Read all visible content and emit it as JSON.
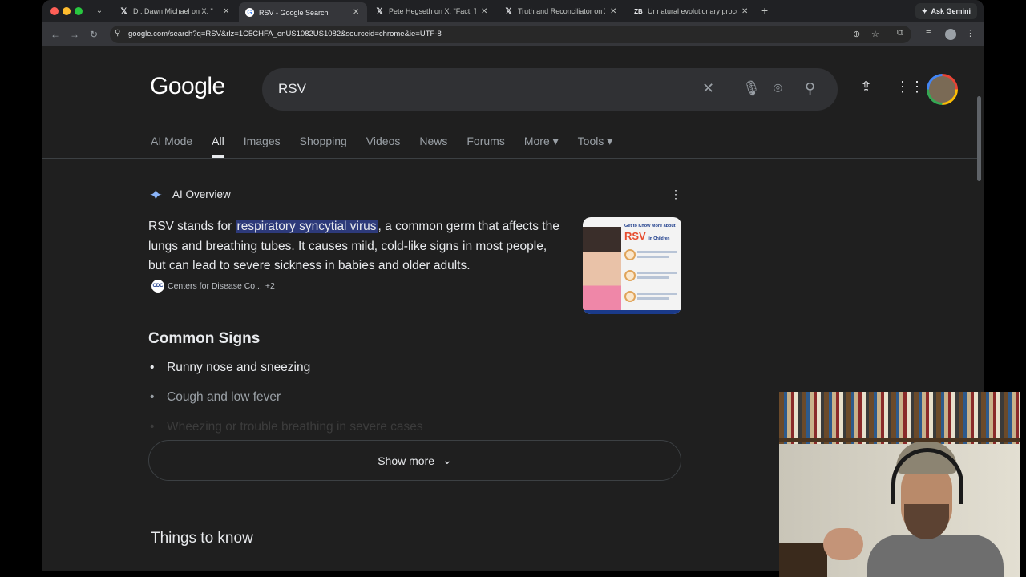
{
  "browser": {
    "tabs": [
      {
        "title": "Dr. Dawn Michael on X: \"",
        "favicon": "x-logo-icon",
        "active": false
      },
      {
        "title": "RSV - Google Search",
        "favicon": "google-g-icon",
        "active": true
      },
      {
        "title": "Pete Hegseth on X: \"Fact. Th",
        "favicon": "x-logo-icon",
        "active": false
      },
      {
        "title": "Truth and Reconciliator on X:",
        "favicon": "x-logo-icon",
        "active": false
      },
      {
        "title": "Unnatural evolutionary proce",
        "favicon": "zb-icon",
        "active": false
      }
    ],
    "ask_gemini": "Ask Gemini",
    "url": "google.com/search?q=RSV&rlz=1C5CHFA_enUS1082US1082&sourceid=chrome&ie=UTF-8"
  },
  "google": {
    "logo": "Google",
    "query": "RSV",
    "nav_tabs": [
      "AI Mode",
      "All",
      "Images",
      "Shopping",
      "Videos",
      "News",
      "Forums",
      "More ▾",
      "Tools ▾"
    ],
    "selected_tab": "All"
  },
  "ai_overview": {
    "title": "AI Overview",
    "text_before": "RSV stands for ",
    "highlight": "respiratory syncytial virus",
    "text_after": ", a common germ that affects the lungs and breathing tubes. It causes mild, cold-like signs in most people, but can lead to severe sickness in babies and older adults.",
    "source_label": "Centers for Disease Co...",
    "source_more": "+2",
    "thumbnail": {
      "header": "Get to Know More about",
      "title": "RSV",
      "subtitle": "in Children"
    },
    "common_signs_heading": "Common Signs",
    "signs": [
      "Runny nose and sneezing",
      "Cough and low fever",
      "Wheezing or trouble breathing in severe cases"
    ],
    "show_more": "Show more",
    "things_to_know": "Things to know"
  },
  "colors": {
    "background": "#1f1f1f",
    "highlight": "#2d3a7a",
    "text": "#e8eaed",
    "muted": "#9aa0a6"
  }
}
